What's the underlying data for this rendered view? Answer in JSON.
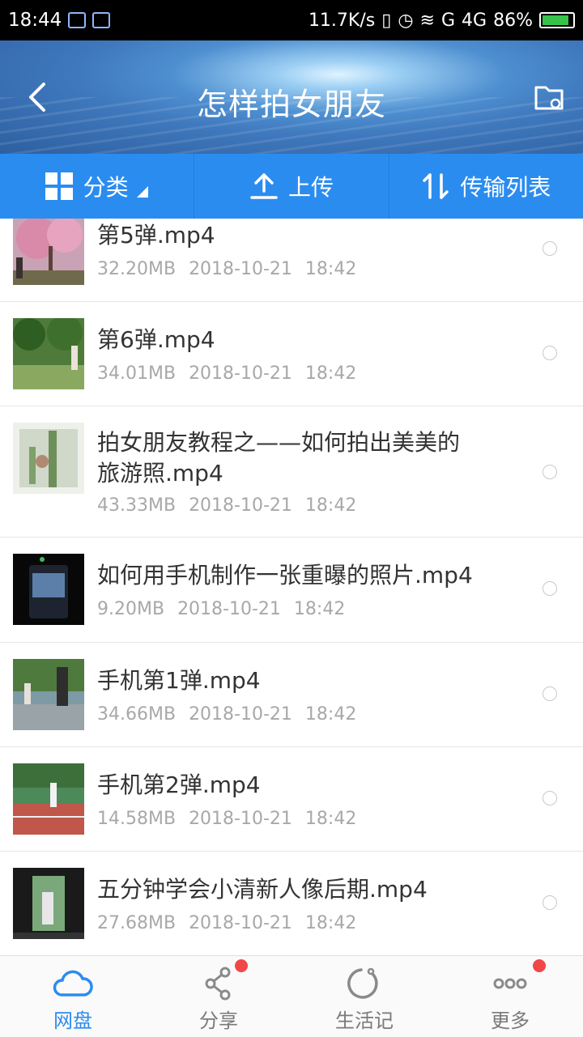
{
  "status_bar": {
    "time": "18:44",
    "speed": "11.7K/s",
    "network": "G",
    "network2": "4G",
    "battery": "86%"
  },
  "header": {
    "title": "怎样拍女朋友"
  },
  "toolbar": {
    "category": "分类",
    "upload": "上传",
    "transfer": "传输列表"
  },
  "files": [
    {
      "name": "第5弹.mp4",
      "size": "32.20MB",
      "date": "2018-10-21",
      "time": "18:42"
    },
    {
      "name": "第6弹.mp4",
      "size": "34.01MB",
      "date": "2018-10-21",
      "time": "18:42"
    },
    {
      "name_line1": "拍女朋友教程之——如何拍出美美的",
      "name_line2": "旅游照.mp4",
      "size": "43.33MB",
      "date": "2018-10-21",
      "time": "18:42"
    },
    {
      "name": "如何用手机制作一张重曝的照片.mp4",
      "size": "9.20MB",
      "date": "2018-10-21",
      "time": "18:42"
    },
    {
      "name": "手机第1弹.mp4",
      "size": "34.66MB",
      "date": "2018-10-21",
      "time": "18:42"
    },
    {
      "name": "手机第2弹.mp4",
      "size": "14.58MB",
      "date": "2018-10-21",
      "time": "18:42"
    },
    {
      "name": "五分钟学会小清新人像后期.mp4",
      "size": "27.68MB",
      "date": "2018-10-21",
      "time": "18:42"
    }
  ],
  "tabs": {
    "disk": "网盘",
    "share": "分享",
    "life": "生活记",
    "more": "更多"
  },
  "colors": {
    "accent": "#2b8cf0",
    "badge": "#f04848"
  }
}
